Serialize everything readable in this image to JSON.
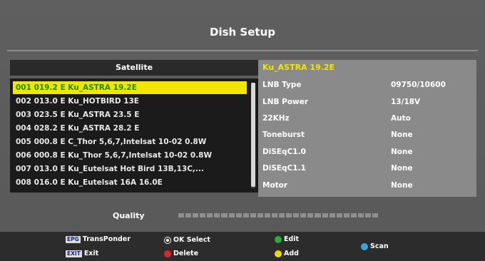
{
  "title": "Dish Setup",
  "satellite_panel": {
    "header": "Satellite",
    "items": [
      {
        "label": "001 019.2 E  Ku_ASTRA 19.2E",
        "selected": true
      },
      {
        "label": "002 013.0 E  Ku_HOTBIRD 13E",
        "selected": false
      },
      {
        "label": "003 023.5 E  Ku_ASTRA 23.5 E",
        "selected": false
      },
      {
        "label": "004 028.2 E  Ku_ASTRA 28.2 E",
        "selected": false
      },
      {
        "label": "005 000.8 E  C_Thor 5,6,7,Intelsat 10-02 0.8W",
        "selected": false
      },
      {
        "label": "006 000.8 E  Ku_Thor 5,6,7,Intelsat 10-02 0.8W",
        "selected": false
      },
      {
        "label": "007 013.0 E  Ku_Eutelsat Hot Bird 13B,13C,...",
        "selected": false
      },
      {
        "label": "008 016.0 E  Ku_Eutelsat 16A 16.0E",
        "selected": false
      }
    ]
  },
  "info_panel": {
    "title": "Ku_ASTRA 19.2E",
    "rows": [
      {
        "label": "LNB Type",
        "value": "09750/10600"
      },
      {
        "label": "LNB Power",
        "value": "13/18V"
      },
      {
        "label": "22KHz",
        "value": "Auto"
      },
      {
        "label": "Toneburst",
        "value": "None"
      },
      {
        "label": "DiSEqC1.0",
        "value": "None"
      },
      {
        "label": "DiSEqC1.1",
        "value": "None"
      },
      {
        "label": "Motor",
        "value": "None"
      }
    ]
  },
  "quality": {
    "label": "Quality",
    "level": 0,
    "segments": 28
  },
  "footer": {
    "transponder": {
      "key": "EPG",
      "label": "TransPonder"
    },
    "exit": {
      "key": "EXIT",
      "label": "Exit"
    },
    "ok_select": {
      "label": "OK Select",
      "icon": "ok-icon"
    },
    "delete": {
      "label": "Delete",
      "icon": "red-dot-icon",
      "color": "#e32222"
    },
    "edit": {
      "label": "Edit",
      "icon": "green-dot-icon",
      "color": "#2fa83a"
    },
    "add": {
      "label": "Add",
      "icon": "yellow-dot-icon",
      "color": "#f2d600"
    },
    "scan": {
      "label": "Scan",
      "icon": "blue-dot-icon",
      "color": "#2fa8e0"
    }
  },
  "colors": {
    "highlight": "#f2e600",
    "highlight_text": "#1f8a1f",
    "info_title": "#f2e600"
  }
}
